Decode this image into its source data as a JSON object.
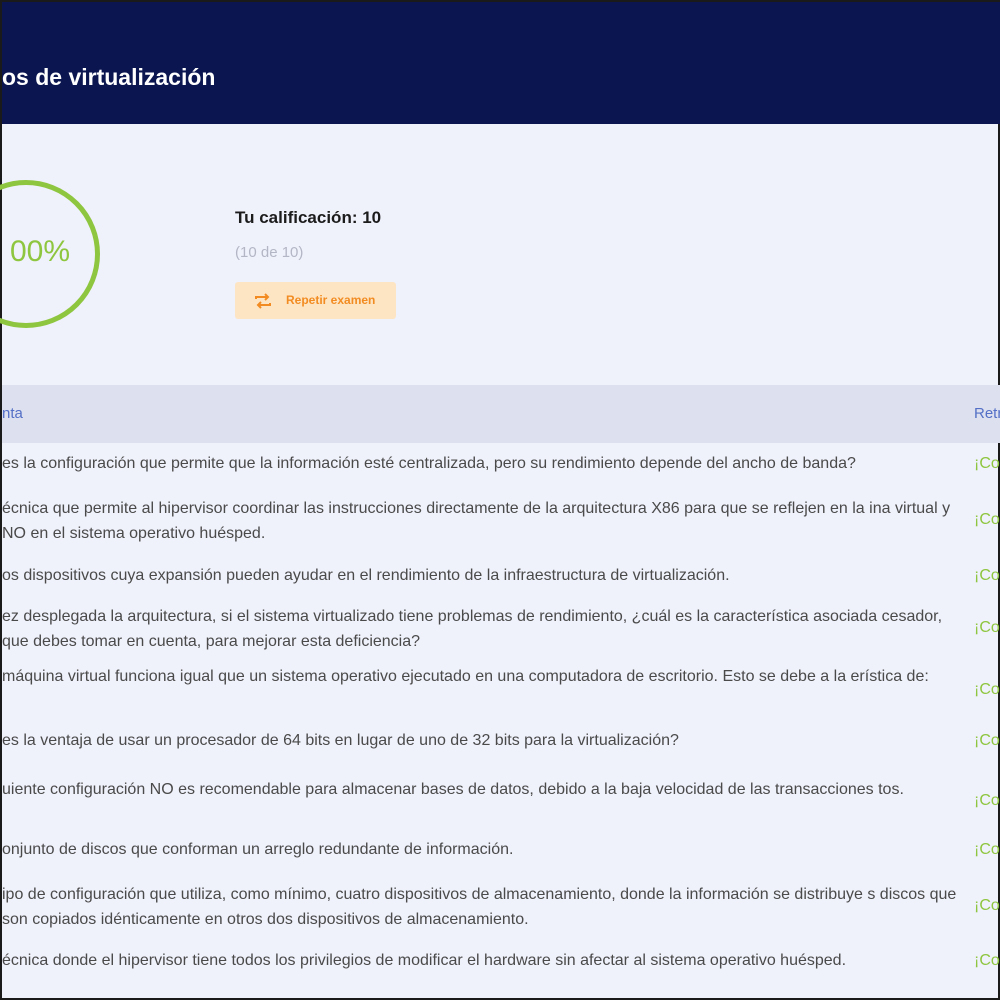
{
  "header": {
    "title": "os de virtualización"
  },
  "result": {
    "percent": "00%",
    "grade_label": "Tu calificación: 10",
    "grade_detail": "(10 de 10)",
    "retry_label": "Repetir examen"
  },
  "table": {
    "col_question": "nta",
    "col_feedback": "Retr",
    "rows": [
      {
        "question": "es la configuración que permite que la información esté centralizada, pero su rendimiento depende del ancho de banda?",
        "feedback": "¡Cor"
      },
      {
        "question": "écnica que permite al hipervisor coordinar las instrucciones directamente de la arquitectura X86 para que se reflejen en la ina virtual y NO en el sistema operativo huésped.",
        "feedback": "¡Cor"
      },
      {
        "question": "os dispositivos cuya expansión pueden ayudar en el rendimiento de la infraestructura de virtualización.",
        "feedback": "¡Cor"
      },
      {
        "question": "ez desplegada la arquitectura, si el sistema virtualizado tiene problemas de rendimiento, ¿cuál es la característica asociada cesador, que debes tomar en cuenta, para mejorar esta deficiencia?",
        "feedback": "¡Cor"
      },
      {
        "question": "máquina virtual funciona igual que un sistema operativo ejecutado en una computadora de escritorio. Esto se debe a la erística de:",
        "feedback": "¡Cor"
      },
      {
        "question": "es la ventaja de usar un procesador de 64 bits en lugar de uno de 32 bits para la virtualización?",
        "feedback": "¡Cor"
      },
      {
        "question": "uiente configuración NO es recomendable para almacenar bases de datos, debido a la baja velocidad de las transacciones tos.",
        "feedback": "¡Cor"
      },
      {
        "question": "onjunto de discos que conforman un arreglo redundante de información.",
        "feedback": "¡Cor"
      },
      {
        "question": "ipo de configuración que utiliza, como mínimo, cuatro dispositivos de almacenamiento, donde la información se distribuye s discos que son copiados idénticamente en otros dos dispositivos de almacenamiento.",
        "feedback": "¡Cor"
      },
      {
        "question": "écnica donde el hipervisor tiene todos los privilegios de modificar el hardware sin afectar al sistema operativo huésped.",
        "feedback": "¡Cor"
      }
    ]
  },
  "colors": {
    "header_bg": "#0b1650",
    "score_green": "#8ec63f",
    "retry_bg": "#fde5c4",
    "retry_text": "#f28c22",
    "table_header_bg": "#dde0ef",
    "table_header_text": "#5470c6",
    "page_bg": "#eff1fb"
  },
  "icons": {
    "retry": "repeat-arrows-icon"
  }
}
